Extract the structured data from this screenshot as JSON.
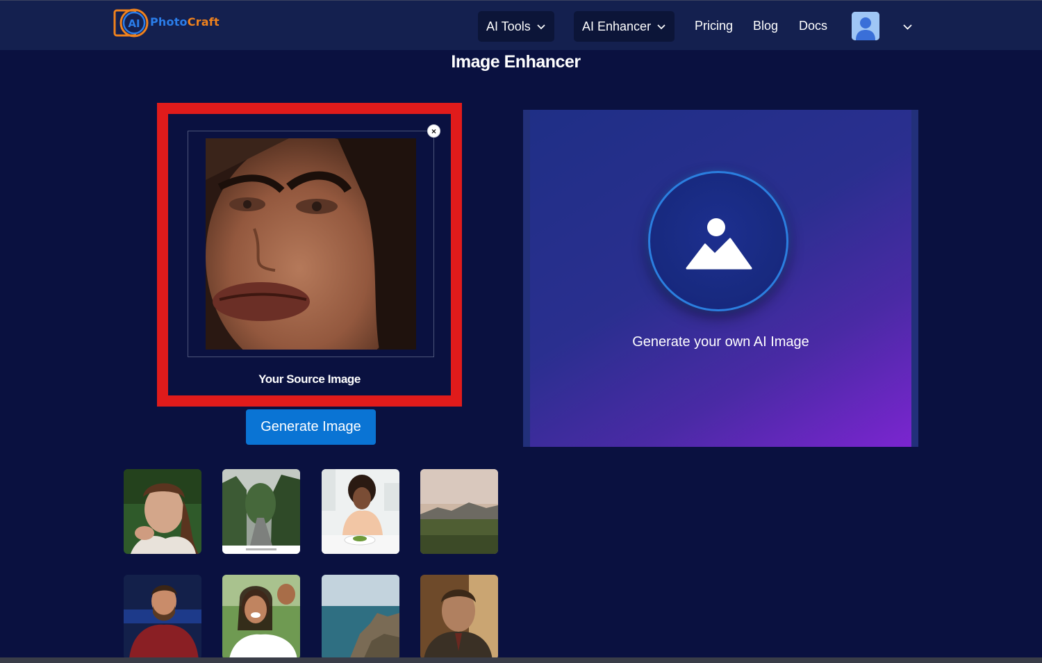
{
  "app": {
    "logo_text_part1": "Photo",
    "logo_text_part2": "Craft",
    "logo_mark_text": "AI"
  },
  "nav": {
    "ai_tools": "AI Tools",
    "ai_enhancer": "AI Enhancer",
    "pricing": "Pricing",
    "blog": "Blog",
    "docs": "Docs"
  },
  "page": {
    "title": "Image Enhancer"
  },
  "source": {
    "label": "Your Source Image",
    "close_symbol": "×"
  },
  "actions": {
    "generate_label": "Generate Image"
  },
  "ai_panel": {
    "text": "Generate your own AI Image"
  },
  "colors": {
    "background": "#0a1140",
    "header": "#14204f",
    "highlight_border": "#e01b1b",
    "primary_button": "#0a74d4",
    "logo_blue": "#2b7de9",
    "logo_orange": "#f0821d"
  },
  "icons": [
    "chevron-down-icon",
    "user-icon",
    "close-icon",
    "image-placeholder-icon"
  ]
}
